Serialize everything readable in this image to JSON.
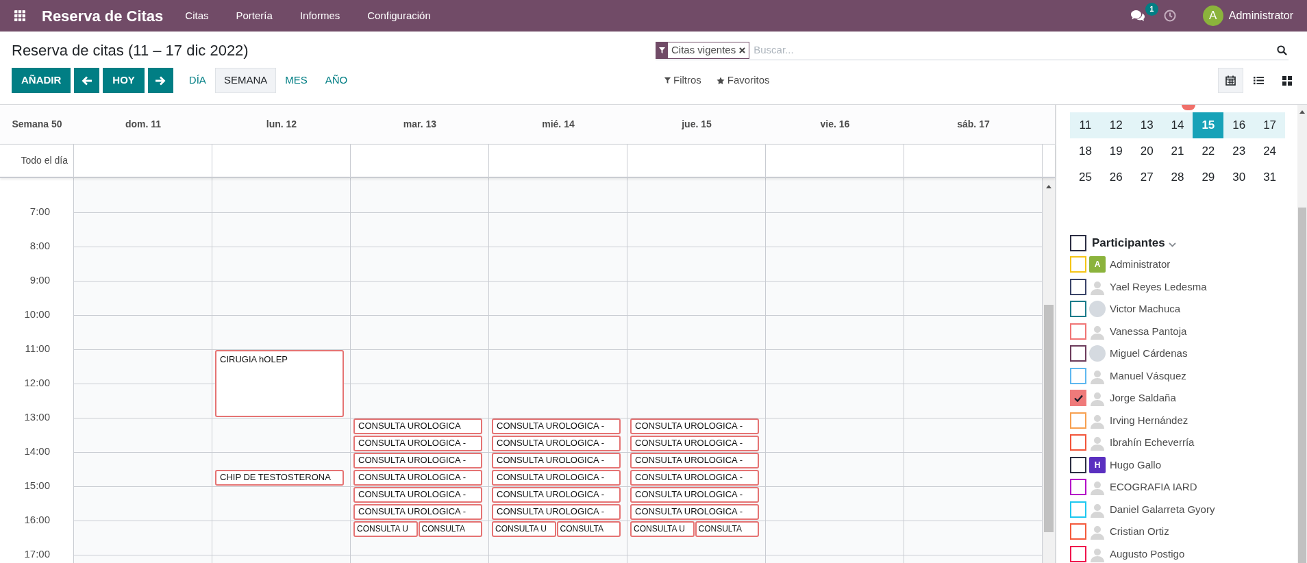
{
  "navbar": {
    "app_title": "Reserva de Citas",
    "menu": [
      "Citas",
      "Portería",
      "Informes",
      "Configuración"
    ],
    "messages_badge": "1",
    "user": {
      "initial": "A",
      "name": "Administrator"
    }
  },
  "control_panel": {
    "title": "Reserva de citas (11 – 17 dic 2022)",
    "search": {
      "facet": "Citas vigentes",
      "placeholder": "Buscar..."
    },
    "buttons": [
      {
        "kind": "text",
        "label": "AÑADIR"
      },
      {
        "kind": "prev"
      },
      {
        "kind": "text",
        "label": "HOY"
      },
      {
        "kind": "next"
      }
    ],
    "scales": [
      {
        "label": "DÍA",
        "selected": false
      },
      {
        "label": "SEMANA",
        "selected": true
      },
      {
        "label": "MES",
        "selected": false
      },
      {
        "label": "AÑO",
        "selected": false
      }
    ],
    "filters": "Filtros",
    "favorites": "Favoritos",
    "views": [
      {
        "kind": "calendar",
        "selected": true
      },
      {
        "kind": "list",
        "selected": false
      },
      {
        "kind": "kanban",
        "selected": false
      }
    ]
  },
  "calendar": {
    "week_label": "Semana 50",
    "all_day_label": "Todo el día",
    "hours": [
      "7:00",
      "8:00",
      "9:00",
      "10:00",
      "11:00",
      "12:00",
      "13:00",
      "14:00",
      "15:00",
      "16:00",
      "17:00"
    ],
    "days": [
      {
        "label": "dom. 11"
      },
      {
        "label": "lun. 12",
        "slots": [
          {
            "kind": "empty"
          },
          {
            "kind": "empty"
          },
          {
            "kind": "empty"
          },
          {
            "kind": "empty"
          },
          {
            "kind": "empty"
          },
          {
            "kind": "empty"
          },
          {
            "kind": "empty"
          },
          {
            "kind": "empty"
          },
          {
            "kind": "empty"
          },
          {
            "kind": "empty"
          },
          {
            "kind": "event",
            "events": [
              {
                "title": "CIRUGIA hOLEP"
              }
            ]
          },
          {
            "kind": "continued"
          },
          {
            "kind": "continued"
          },
          {
            "kind": "continued"
          },
          {
            "kind": "empty"
          },
          {
            "kind": "empty"
          },
          {
            "kind": "empty"
          },
          {
            "kind": "event",
            "events": [
              {
                "title": "CHIP DE TESTOSTERONA"
              }
            ]
          }
        ]
      },
      {
        "label": "mar. 13",
        "slots": [
          {
            "kind": "empty"
          },
          {
            "kind": "empty"
          },
          {
            "kind": "empty"
          },
          {
            "kind": "empty"
          },
          {
            "kind": "empty"
          },
          {
            "kind": "empty"
          },
          {
            "kind": "empty"
          },
          {
            "kind": "empty"
          },
          {
            "kind": "empty"
          },
          {
            "kind": "empty"
          },
          {
            "kind": "empty"
          },
          {
            "kind": "empty"
          },
          {
            "kind": "empty"
          },
          {
            "kind": "empty"
          },
          {
            "kind": "event",
            "events": [
              {
                "title": "CONSULTA UROLOGICA"
              }
            ]
          },
          {
            "kind": "event",
            "events": [
              {
                "title": "CONSULTA UROLOGICA -"
              }
            ]
          },
          {
            "kind": "event",
            "events": [
              {
                "title": "CONSULTA UROLOGICA -"
              }
            ]
          },
          {
            "kind": "event",
            "events": [
              {
                "title": "CONSULTA UROLOGICA -"
              }
            ]
          },
          {
            "kind": "event",
            "events": [
              {
                "title": "CONSULTA UROLOGICA -"
              }
            ]
          },
          {
            "kind": "event",
            "events": [
              {
                "title": "CONSULTA UROLOGICA -"
              }
            ]
          },
          {
            "kind": "event",
            "events": [
              {
                "title": "CONSULTA U"
              },
              {
                "title": "CONSULTA"
              }
            ]
          }
        ]
      },
      {
        "label": "mié. 14",
        "slots": [
          {
            "kind": "empty"
          },
          {
            "kind": "empty"
          },
          {
            "kind": "empty"
          },
          {
            "kind": "empty"
          },
          {
            "kind": "empty"
          },
          {
            "kind": "empty"
          },
          {
            "kind": "empty"
          },
          {
            "kind": "empty"
          },
          {
            "kind": "empty"
          },
          {
            "kind": "empty"
          },
          {
            "kind": "empty"
          },
          {
            "kind": "empty"
          },
          {
            "kind": "empty"
          },
          {
            "kind": "empty"
          },
          {
            "kind": "event",
            "events": [
              {
                "title": "CONSULTA UROLOGICA -"
              }
            ]
          },
          {
            "kind": "event",
            "events": [
              {
                "title": "CONSULTA UROLOGICA -"
              }
            ]
          },
          {
            "kind": "event",
            "events": [
              {
                "title": "CONSULTA UROLOGICA -"
              }
            ]
          },
          {
            "kind": "event",
            "events": [
              {
                "title": "CONSULTA UROLOGICA -"
              }
            ]
          },
          {
            "kind": "event",
            "events": [
              {
                "title": "CONSULTA UROLOGICA -"
              }
            ]
          },
          {
            "kind": "event",
            "events": [
              {
                "title": "CONSULTA UROLOGICA -"
              }
            ]
          },
          {
            "kind": "event",
            "events": [
              {
                "title": "CONSULTA U"
              },
              {
                "title": "CONSULTA"
              }
            ]
          }
        ]
      },
      {
        "label": "jue. 15",
        "slots": [
          {
            "kind": "empty"
          },
          {
            "kind": "empty"
          },
          {
            "kind": "empty"
          },
          {
            "kind": "empty"
          },
          {
            "kind": "empty"
          },
          {
            "kind": "empty"
          },
          {
            "kind": "empty"
          },
          {
            "kind": "empty"
          },
          {
            "kind": "empty"
          },
          {
            "kind": "empty"
          },
          {
            "kind": "empty"
          },
          {
            "kind": "empty"
          },
          {
            "kind": "empty"
          },
          {
            "kind": "empty"
          },
          {
            "kind": "event",
            "events": [
              {
                "title": "CONSULTA UROLOGICA -"
              }
            ]
          },
          {
            "kind": "event",
            "events": [
              {
                "title": "CONSULTA UROLOGICA -"
              }
            ]
          },
          {
            "kind": "event",
            "events": [
              {
                "title": "CONSULTA UROLOGICA -"
              }
            ]
          },
          {
            "kind": "event",
            "events": [
              {
                "title": "CONSULTA UROLOGICA -"
              }
            ]
          },
          {
            "kind": "event",
            "events": [
              {
                "title": "CONSULTA UROLOGICA -"
              }
            ]
          },
          {
            "kind": "event",
            "events": [
              {
                "title": "CONSULTA UROLOGICA -"
              }
            ]
          },
          {
            "kind": "event",
            "events": [
              {
                "title": "CONSULTA U"
              },
              {
                "title": "CONSULTA"
              }
            ]
          }
        ]
      },
      {
        "label": "vie. 16"
      },
      {
        "label": "sáb. 17"
      }
    ]
  },
  "sidebar": {
    "mini_calendar": {
      "weeks": [
        {
          "highlighted": true,
          "days": [
            {
              "label": "11",
              "selected": false
            },
            {
              "label": "12",
              "selected": false
            },
            {
              "label": "13",
              "selected": false
            },
            {
              "label": "14",
              "selected": false
            },
            {
              "label": "15",
              "selected": true
            },
            {
              "label": "16",
              "selected": false
            },
            {
              "label": "17",
              "selected": false
            }
          ]
        },
        {
          "highlighted": false,
          "days": [
            {
              "label": "18",
              "selected": false
            },
            {
              "label": "19",
              "selected": false
            },
            {
              "label": "20",
              "selected": false
            },
            {
              "label": "21",
              "selected": false
            },
            {
              "label": "22",
              "selected": false
            },
            {
              "label": "23",
              "selected": false
            },
            {
              "label": "24",
              "selected": false
            }
          ]
        },
        {
          "highlighted": false,
          "days": [
            {
              "label": "25",
              "selected": false
            },
            {
              "label": "26",
              "selected": false
            },
            {
              "label": "27",
              "selected": false
            },
            {
              "label": "28",
              "selected": false
            },
            {
              "label": "29",
              "selected": false
            },
            {
              "label": "30",
              "selected": false
            },
            {
              "label": "31",
              "selected": false
            }
          ]
        }
      ]
    },
    "participants": {
      "title": "Participantes",
      "checked": false,
      "items": [
        {
          "name": "Administrator",
          "color": "#f5c518",
          "checked": false,
          "avatar": {
            "kind": "initial",
            "text": "A",
            "color": "#8bb33c"
          }
        },
        {
          "name": "Yael Reyes Ledesma",
          "color": "#3a4468",
          "checked": false,
          "avatar": {
            "kind": "silhouette"
          }
        },
        {
          "name": "Victor Machuca",
          "color": "#1b7b8a",
          "checked": false,
          "avatar": {
            "kind": "photo"
          }
        },
        {
          "name": "Vanessa Pantoja",
          "color": "#f07575",
          "checked": false,
          "avatar": {
            "kind": "silhouette"
          }
        },
        {
          "name": "Miguel Cárdenas",
          "color": "#6c3b5b",
          "checked": false,
          "avatar": {
            "kind": "photo"
          }
        },
        {
          "name": "Manuel Vásquez",
          "color": "#5fb8f0",
          "checked": false,
          "avatar": {
            "kind": "silhouette"
          }
        },
        {
          "name": "Jorge Saldaña",
          "color": "#ef7a7a",
          "checked": true,
          "avatar": {
            "kind": "silhouette"
          }
        },
        {
          "name": "Irving Hernández",
          "color": "#f7a050",
          "checked": false,
          "avatar": {
            "kind": "silhouette"
          }
        },
        {
          "name": "Ibrahín Echeverría",
          "color": "#f2553a",
          "checked": false,
          "avatar": {
            "kind": "silhouette"
          }
        },
        {
          "name": "Hugo Gallo",
          "color": "#2b2d42",
          "checked": false,
          "avatar": {
            "kind": "initial",
            "text": "H",
            "color": "#5a2fc0"
          }
        },
        {
          "name": "ECOGRAFIA IARD",
          "color": "#b400c8",
          "checked": false,
          "avatar": {
            "kind": "silhouette"
          }
        },
        {
          "name": "Daniel Galarreta Gyory",
          "color": "#1ec8f0",
          "checked": false,
          "avatar": {
            "kind": "silhouette"
          }
        },
        {
          "name": "Cristian Ortiz",
          "color": "#f45a3c",
          "checked": false,
          "avatar": {
            "kind": "silhouette"
          }
        },
        {
          "name": "Augusto Postigo",
          "color": "#f0134d",
          "checked": false,
          "avatar": {
            "kind": "silhouette"
          }
        }
      ]
    }
  }
}
